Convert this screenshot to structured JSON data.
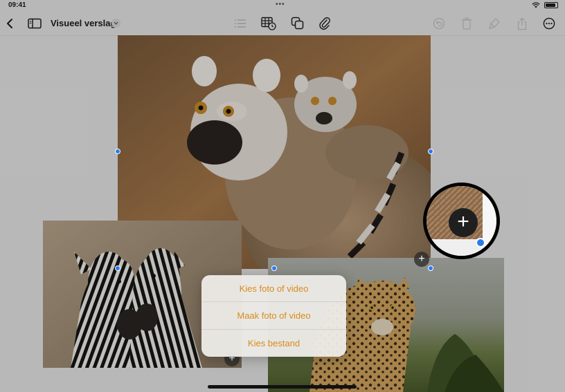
{
  "status_bar": {
    "time": "09:41",
    "multitask_dots": "•••"
  },
  "toolbar": {
    "back_icon": "chevron-left-icon",
    "sidebar_icon": "sidebar-icon",
    "document_title": "Visueel verslag",
    "title_menu_icon": "chevron-down-icon",
    "center_icons": [
      "list-icon",
      "table-media-icon",
      "copy-shape-icon",
      "paperclip-icon"
    ],
    "right_icons": [
      "undo-icon",
      "delete-icon",
      "format-brush-icon",
      "share-icon",
      "more-icon"
    ]
  },
  "canvas": {
    "photos": [
      "lemur",
      "zebras",
      "leopard"
    ],
    "add_button_label": "+"
  },
  "zoom_lens": {
    "plus_label": "+"
  },
  "insert_menu": {
    "items": [
      "Kies foto of video",
      "Maak foto of video",
      "Kies bestand"
    ],
    "accent_color": "#D98B1E"
  }
}
